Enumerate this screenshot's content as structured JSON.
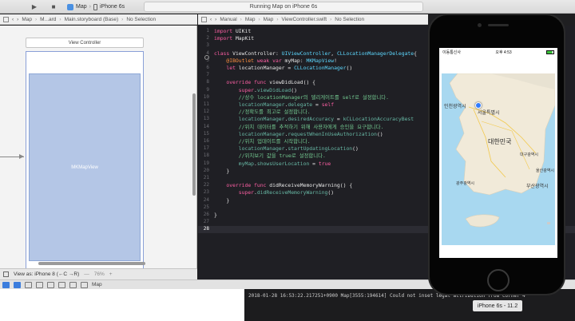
{
  "toolbar": {
    "scheme_app": "Map",
    "scheme_device": "iPhone 6s",
    "status_text": "Running Map on iPhone 6s"
  },
  "jumpbar_left": {
    "items": [
      "Map",
      "M...ard",
      "Main.storyboard (Base)",
      "No Selection"
    ]
  },
  "jumpbar_right": {
    "items": [
      "Manual",
      "Map",
      "Map",
      "ViewController.swift",
      "No Selection"
    ]
  },
  "storyboard": {
    "vc_title": "View Controller",
    "mapview_label": "MKMapView"
  },
  "bottombar": {
    "view_as": "View as: iPhone 8 (←C →R)",
    "zoom": "76%"
  },
  "debugbar": {
    "target": "Map"
  },
  "editor": {
    "current_line": "28",
    "lines": [
      {
        "n": "1",
        "html": "<span class='kw'>import</span> <span class='tx'>UIKit</span>"
      },
      {
        "n": "2",
        "html": "<span class='kw'>import</span> <span class='tx'>MapKit</span>"
      },
      {
        "n": "3",
        "html": ""
      },
      {
        "n": "4",
        "html": "<span class='kw'>class</span> <span class='tx'>ViewController: </span><span class='ty'>UIViewController</span><span class='tx'>, </span><span class='ty'>CLLocationManagerDelegate</span><span class='tx'>{</span>"
      },
      {
        "n": "5",
        "html": "    <span class='at'>@IBOutlet</span> <span class='kw'>weak var</span> <span class='tx'>myMap: </span><span class='ty'>MKMapView</span><span class='tx'>!</span>"
      },
      {
        "n": "6",
        "html": "    <span class='kw'>let</span> <span class='tx'>locationManager = </span><span class='ty'>CLLocationManager</span><span class='tx'>()</span>"
      },
      {
        "n": "7",
        "html": ""
      },
      {
        "n": "8",
        "html": "    <span class='kw'>override func</span> <span class='tx'>viewDidLoad() {</span>"
      },
      {
        "n": "9",
        "html": "        <span class='kw'>super</span><span class='tx'>.</span><span class='fn'>viewDidLoad</span><span class='tx'>()</span>"
      },
      {
        "n": "10",
        "html": "        <span class='cm'>//상수 locationManager의 델리게이트를 self로 설정합니다.</span>"
      },
      {
        "n": "11",
        "html": "        <span class='fn'>locationManager</span><span class='tx'>.</span><span class='fn'>delegate</span><span class='tx'> = </span><span class='kw'>self</span>"
      },
      {
        "n": "12",
        "html": "        <span class='cm'>//정확도를 최고로 설정합니다.</span>"
      },
      {
        "n": "13",
        "html": "        <span class='fn'>locationManager</span><span class='tx'>.</span><span class='fn'>desiredAccuracy</span><span class='tx'> = </span><span class='fn'>kCLLocationAccuracyBest</span>"
      },
      {
        "n": "14",
        "html": "        <span class='cm'>//위치 데이터를 추적하기 위해 사용자에게 승인을 요구합니다.</span>"
      },
      {
        "n": "15",
        "html": "        <span class='fn'>locationManager</span><span class='tx'>.</span><span class='fn'>requestWhenInUseAuthorization</span><span class='tx'>()</span>"
      },
      {
        "n": "16",
        "html": "        <span class='cm'>//위치 업데이트를 시작합니다.</span>"
      },
      {
        "n": "17",
        "html": "        <span class='fn'>locationManager</span><span class='tx'>.</span><span class='fn'>startUpdatingLocation</span><span class='tx'>()</span>"
      },
      {
        "n": "18",
        "html": "        <span class='cm'>//위치보기 값을 true로 설정합니다.</span>"
      },
      {
        "n": "19",
        "html": "        <span class='fn'>myMap</span><span class='tx'>.</span><span class='fn'>showsUserLocation</span><span class='tx'> = </span><span class='kw'>true</span>"
      },
      {
        "n": "20",
        "html": "    <span class='tx'>}</span>"
      },
      {
        "n": "21",
        "html": ""
      },
      {
        "n": "22",
        "html": "    <span class='kw'>override func</span> <span class='tx'>didReceiveMemoryWarning() {</span>"
      },
      {
        "n": "23",
        "html": "        <span class='kw'>super</span><span class='tx'>.</span><span class='fn'>didReceiveMemoryWarning</span><span class='tx'>()</span>"
      },
      {
        "n": "24",
        "html": "    <span class='tx'>}</span>"
      },
      {
        "n": "25",
        "html": ""
      },
      {
        "n": "26",
        "html": "<span class='tx'>}</span>"
      },
      {
        "n": "27",
        "html": ""
      },
      {
        "n": "28",
        "html": ""
      }
    ]
  },
  "simulator": {
    "carrier": "이동통신사",
    "time": "오후 4:53",
    "device_label": "iPhone 6s - 11.2",
    "map_labels": {
      "incheon": "인천광역시",
      "seoul": "서울특별시",
      "korea": "대한민국",
      "daegu": "대구광역시",
      "ulsan": "울산광역시",
      "gwangju": "광주광역시",
      "busan": "부산광역시"
    }
  },
  "console": {
    "log": "2018-01-28 16:53:22.217251+0900 Map[3555:194614] Could not inset legal attribution from corner 4"
  }
}
